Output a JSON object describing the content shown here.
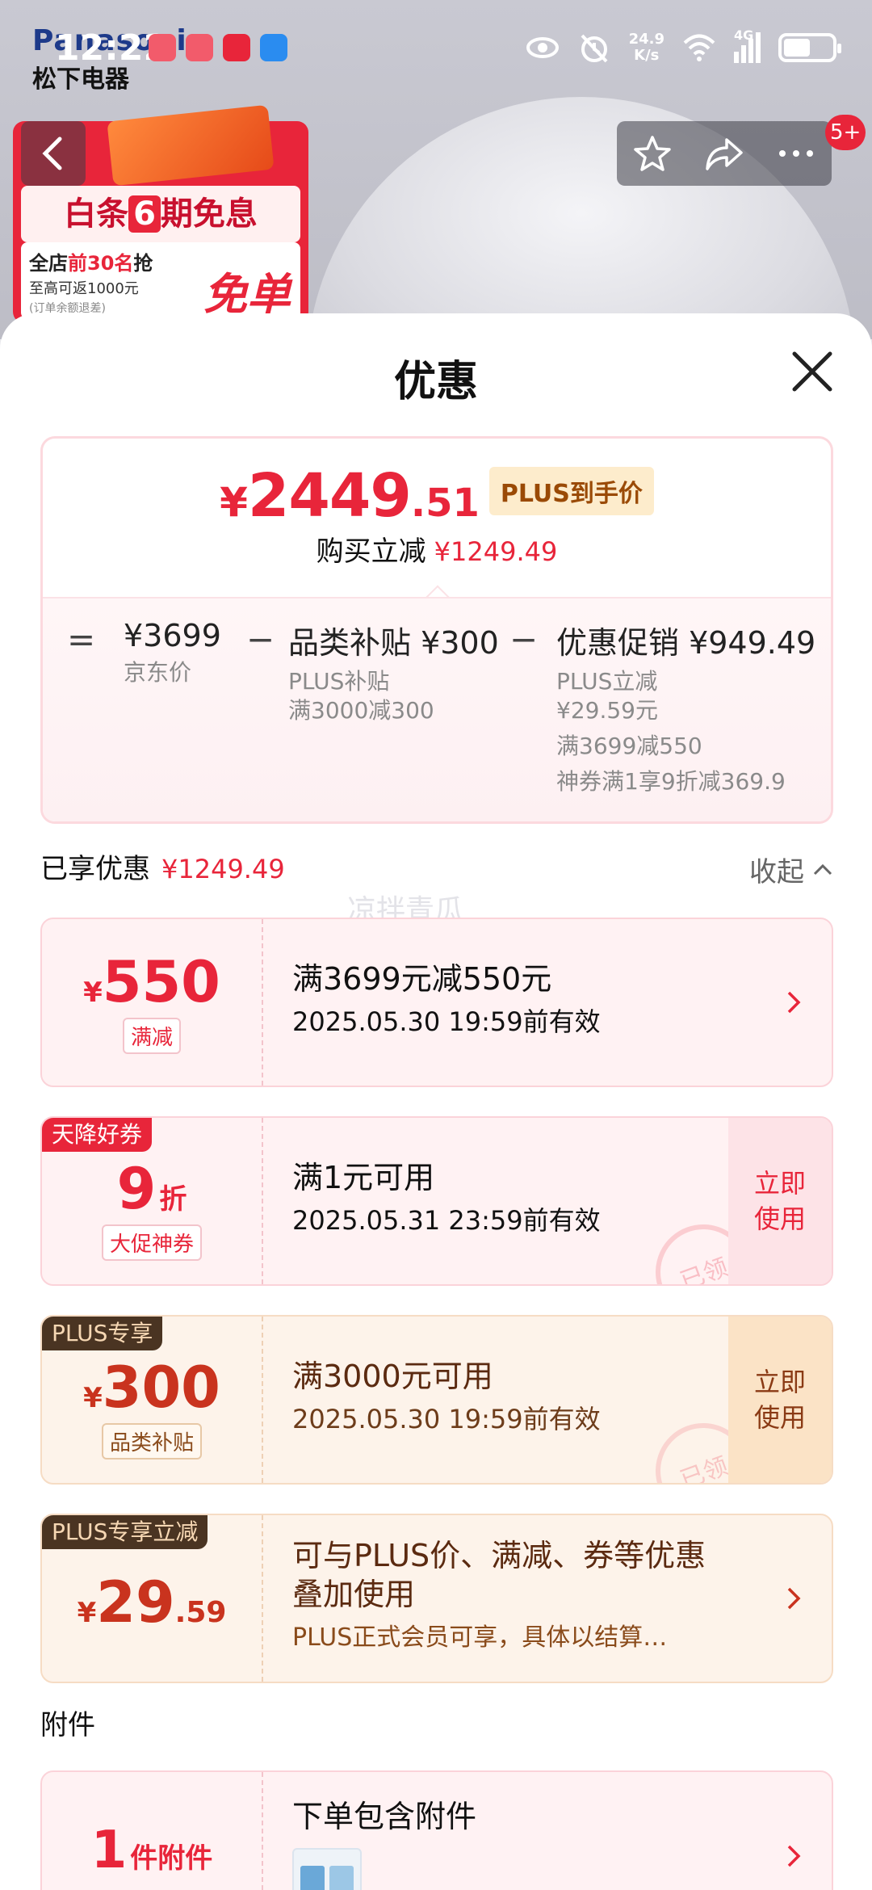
{
  "status_bar": {
    "time": "12:22",
    "net_speed_value": "24.9",
    "net_speed_unit": "K/s",
    "network": "4G",
    "battery_percent": 55
  },
  "background": {
    "brand_top": "Panasonic",
    "brand_bottom": "松下电器",
    "promo_title_pre": "白条",
    "promo_title_num": "6",
    "promo_title_post": "期免息",
    "promo_line1_pre": "全店",
    "promo_line1_red": "前30名",
    "promo_line1_post": "抢",
    "promo_line2": "至高可返1000元",
    "promo_line3": "(订单余额退差)",
    "promo_free": "免单"
  },
  "nav": {
    "badge": "5+"
  },
  "sheet": {
    "title": "优惠"
  },
  "summary": {
    "price_symbol": "¥",
    "price_int": "2449",
    "price_dec": ".51",
    "plus_tag": "PLUS到手价",
    "save_label": "购买立减",
    "save_amount": "¥1249.49",
    "eq": "=",
    "minus": "−",
    "col1_main": "¥3699",
    "col1_sub": "京东价",
    "col2_main": "品类补贴 ¥300",
    "col2_sub1": "PLUS补贴",
    "col2_sub2": "满3000减300",
    "col3_main": "优惠促销 ¥949.49",
    "col3_sub1": "PLUS立减",
    "col3_sub2": "¥29.59元",
    "col3_sub3": "满3699减550",
    "col3_sub4": "神券满1享9折减369.9"
  },
  "enjoyed": {
    "label": "已享优惠",
    "amount": "¥1249.49",
    "collapse": "收起",
    "watermark": "凉拌青瓜"
  },
  "coupons": [
    {
      "sym": "¥",
      "num": "550",
      "label": "满减",
      "title": "满3699元减550元",
      "date": "2025.05.30 19:59前有效"
    },
    {
      "tag": "天降好券",
      "num": "9",
      "unit": "折",
      "label": "大促神券",
      "title": "满1元可用",
      "date": "2025.05.31 23:59前有效",
      "button": "立即使用",
      "stamp": "已领"
    },
    {
      "tag": "PLUS专享",
      "sym": "¥",
      "num": "300",
      "label": "品类补贴",
      "title": "满3000元可用",
      "date": "2025.05.30 19:59前有效",
      "button": "立即使用",
      "stamp": "已领"
    },
    {
      "tag": "PLUS专享立减",
      "sym": "¥",
      "num": "29",
      "dec": ".59",
      "title_line1": "可与PLUS价、满减、券等优惠",
      "title_line2": "叠加使用",
      "desc": "PLUS正式会员可享，具体以结算…"
    }
  ],
  "accessory": {
    "section_title": "附件",
    "num": "1",
    "unit": "件附件",
    "title": "下单包含附件"
  }
}
